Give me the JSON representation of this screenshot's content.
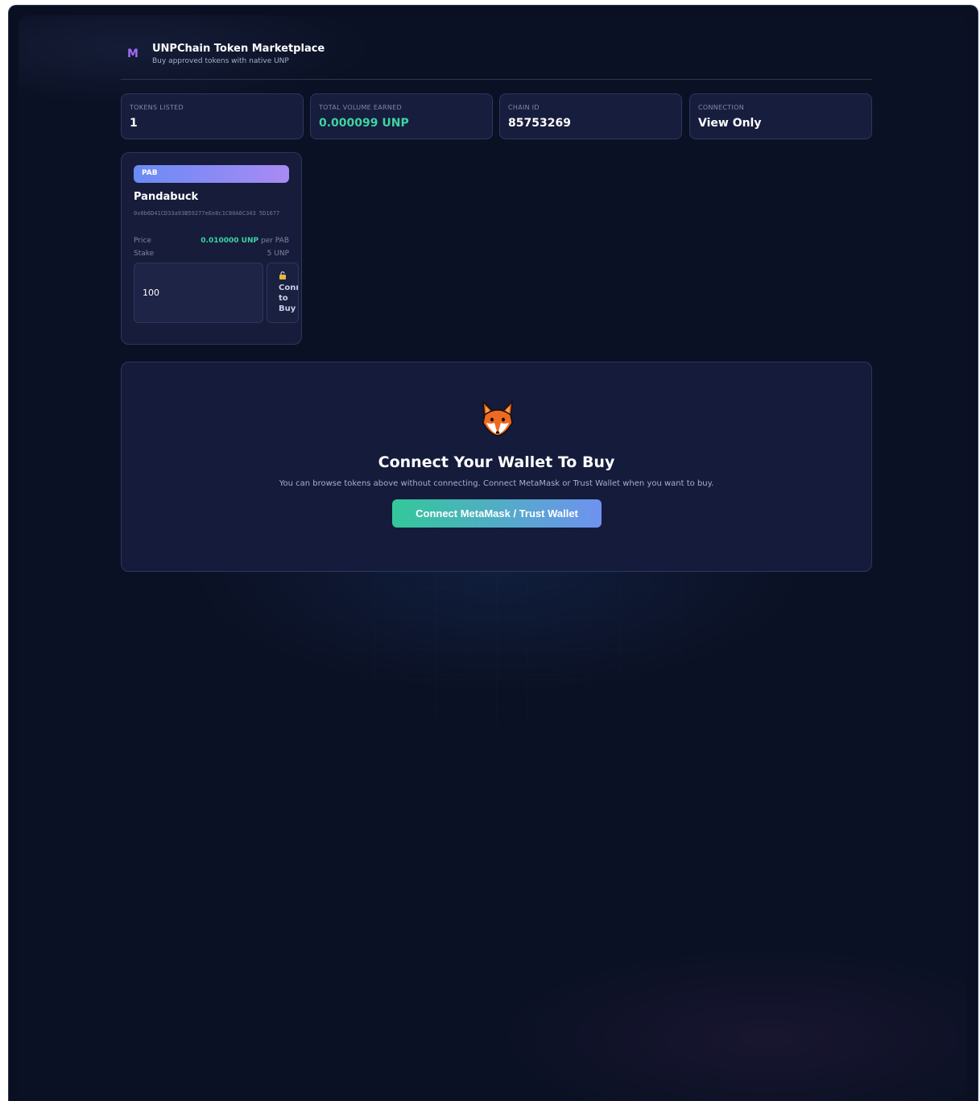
{
  "header": {
    "logo_letter": "M",
    "title": "UNPChain Token Marketplace",
    "subtitle": "Buy approved tokens with native UNP"
  },
  "stats": [
    {
      "label": "TOKENS LISTED",
      "value": "1"
    },
    {
      "label": "TOTAL VOLUME EARNED",
      "value": "0.000099 UNP"
    },
    {
      "label": "CHAIN ID",
      "value": "85753269"
    },
    {
      "label": "CONNECTION",
      "value": "View Only"
    }
  ],
  "token": {
    "symbol": "PAB",
    "name": "Pandabuck",
    "address": "0x0b6D41CD33a93B59277eEe8c1C80A6C343 5D1677",
    "price_label": "Price",
    "price_value": "0.010000 UNP",
    "price_unit": "per PAB",
    "stake_label": "Stake",
    "stake_value": "5 UNP",
    "quantity_value": "100",
    "buy_button_label": "Connect to Buy"
  },
  "connect": {
    "title": "Connect Your Wallet To Buy",
    "description": "You can browse tokens above without connecting. Connect MetaMask or Trust Wallet when you want to buy.",
    "button_label": "Connect MetaMask / Trust Wallet"
  },
  "colors": {
    "background": "#0b1124",
    "card": "#171d3c",
    "accent_green": "#3ed3a0",
    "accent_purple": "#a06cf3",
    "accent_blue": "#6f92f0"
  },
  "icons": {
    "lock": "lock-icon",
    "fox": "fox-icon"
  }
}
